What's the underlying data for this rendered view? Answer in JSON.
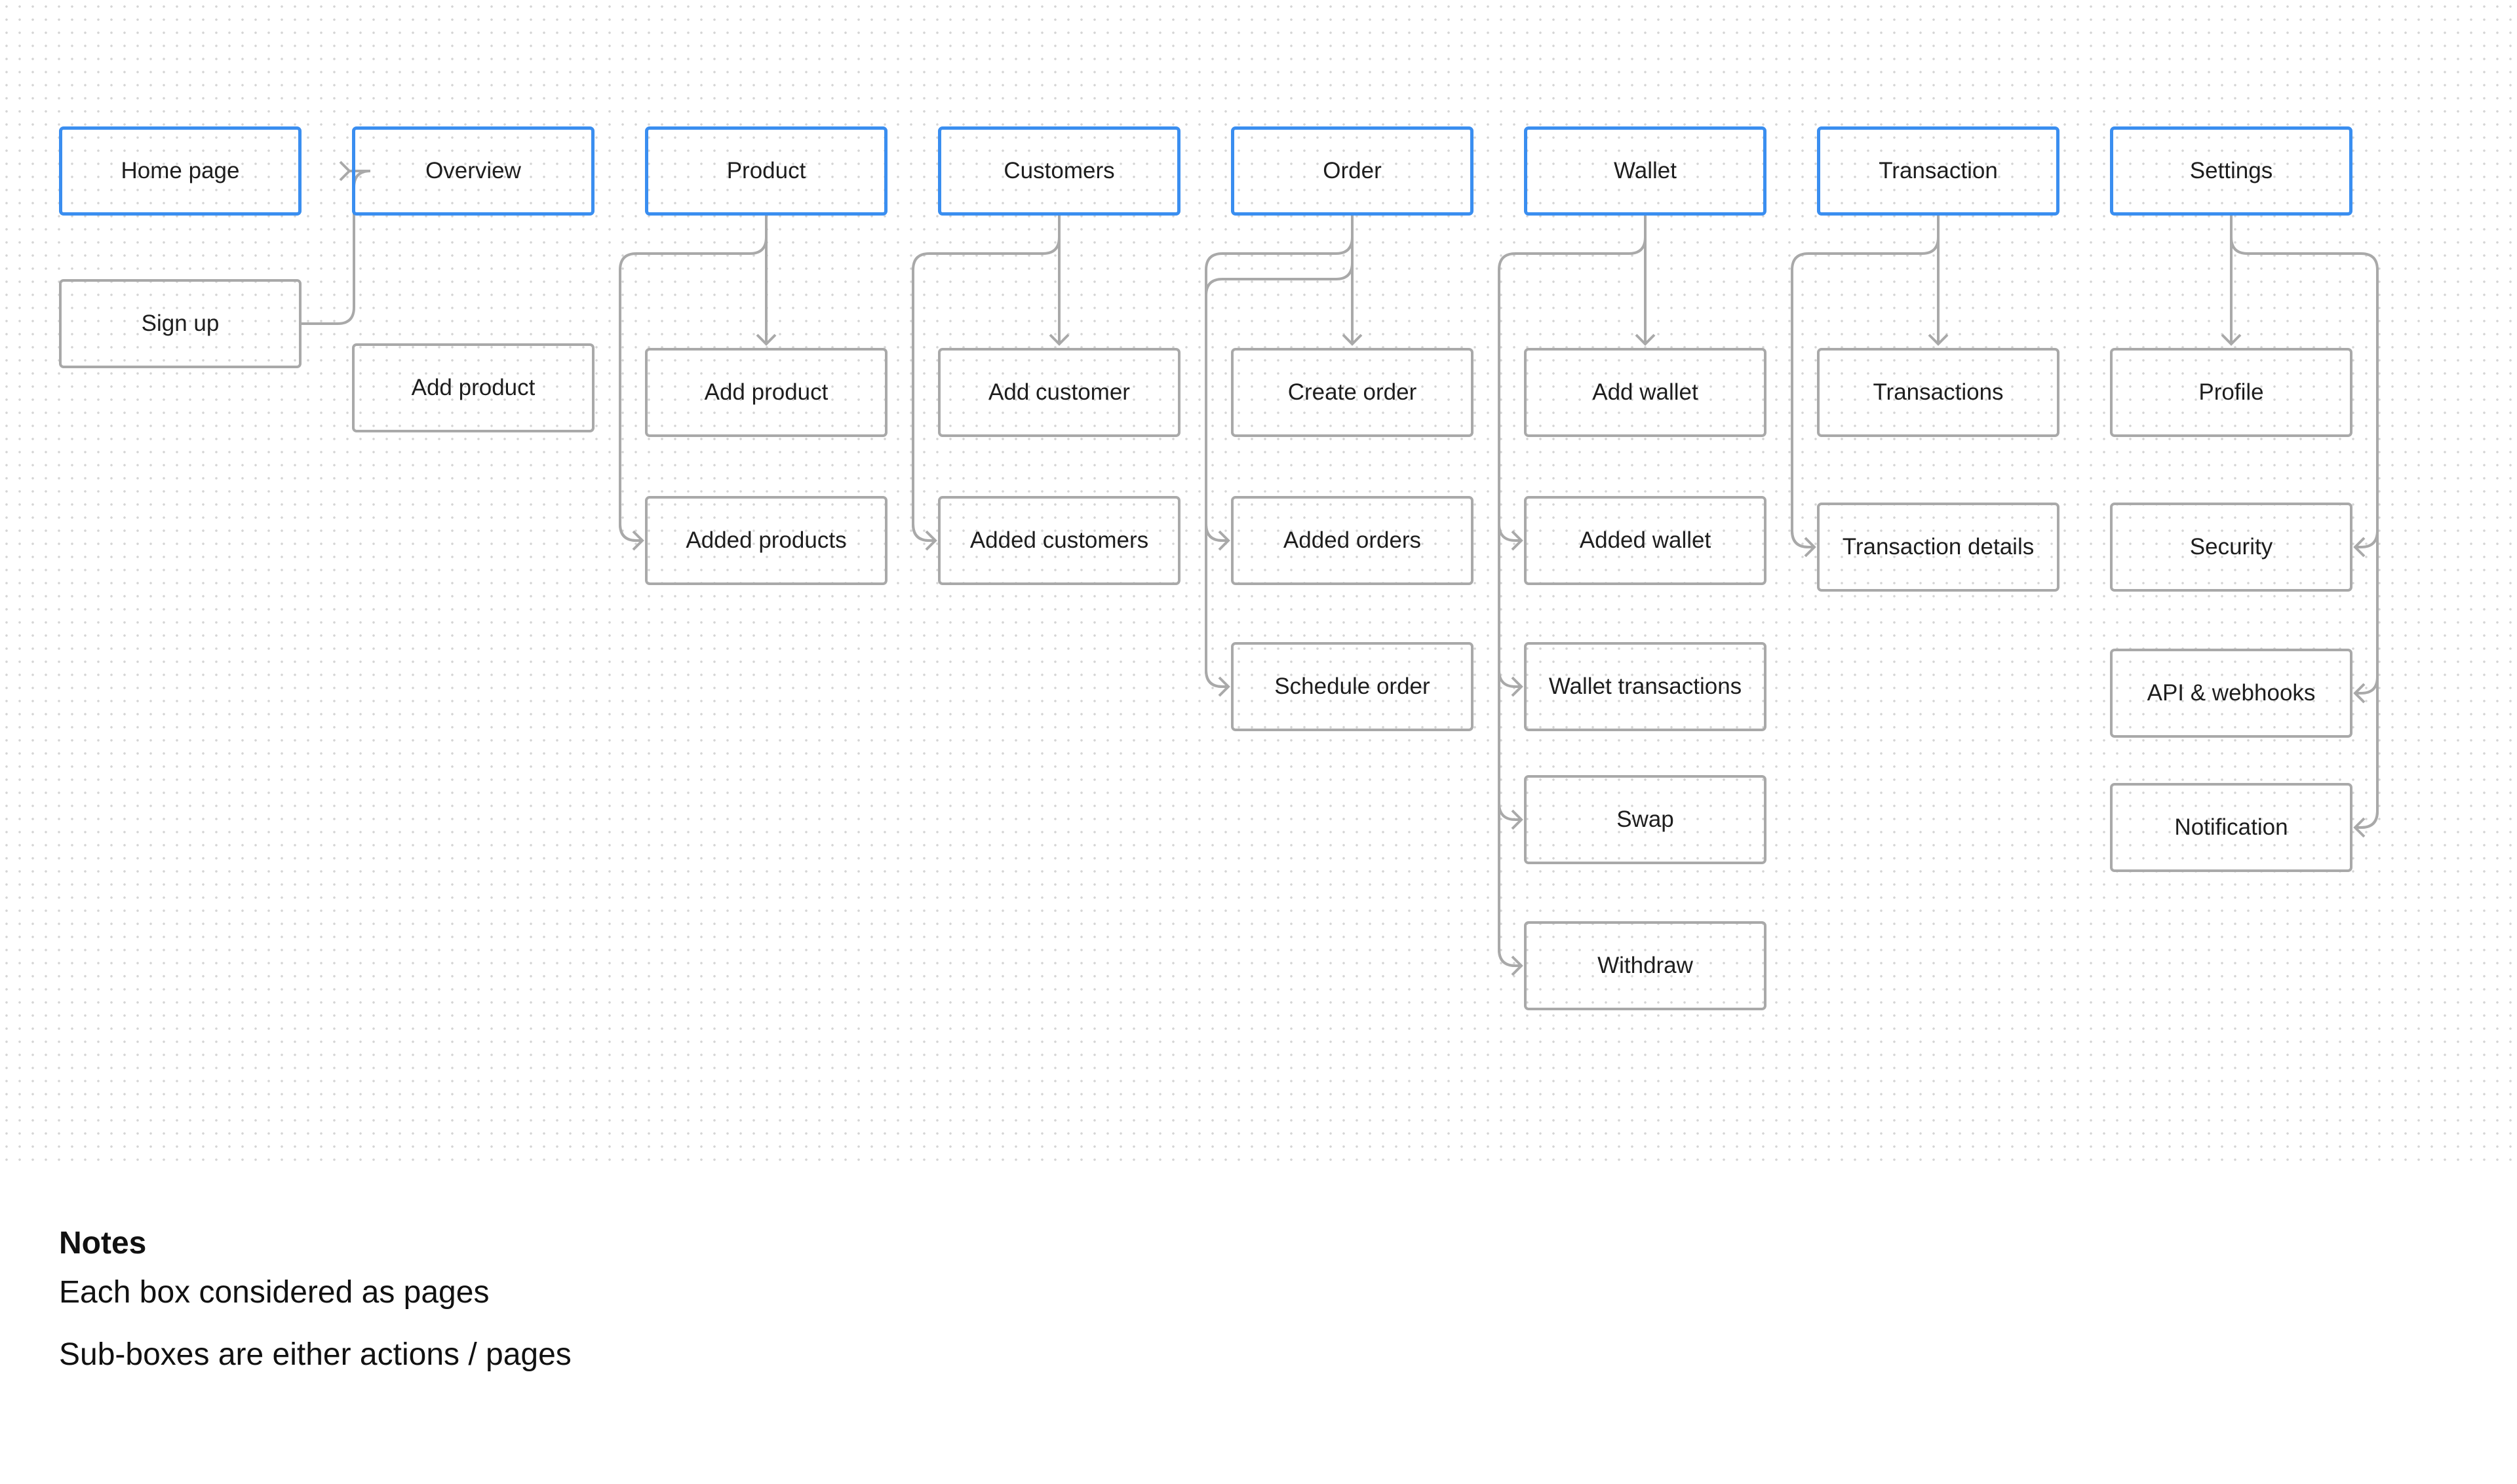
{
  "diagram": {
    "colors": {
      "page_box_border": "#3a8ef0",
      "sub_box_border": "#a9a9a9",
      "connector": "#a9a9a9"
    },
    "columns": [
      {
        "header": "Home page",
        "children": [
          "Sign up"
        ]
      },
      {
        "header": "Overview",
        "children": [
          "Add product"
        ]
      },
      {
        "header": "Product",
        "children": [
          "Add product",
          "Added products"
        ]
      },
      {
        "header": "Customers",
        "children": [
          "Add customer",
          "Added customers"
        ]
      },
      {
        "header": "Order",
        "children": [
          "Create order",
          "Added orders",
          "Schedule order"
        ]
      },
      {
        "header": "Wallet",
        "children": [
          "Add wallet",
          "Added wallet",
          "Wallet transactions",
          "Swap",
          "Withdraw"
        ]
      },
      {
        "header": "Transaction",
        "children": [
          "Transactions",
          "Transaction details"
        ]
      },
      {
        "header": "Settings",
        "children": [
          "Profile",
          "Security",
          "API & webhooks",
          "Notification"
        ]
      }
    ]
  },
  "notes": {
    "title": "Notes",
    "lines": [
      "Each box considered as pages",
      "Sub-boxes are either actions / pages"
    ]
  }
}
